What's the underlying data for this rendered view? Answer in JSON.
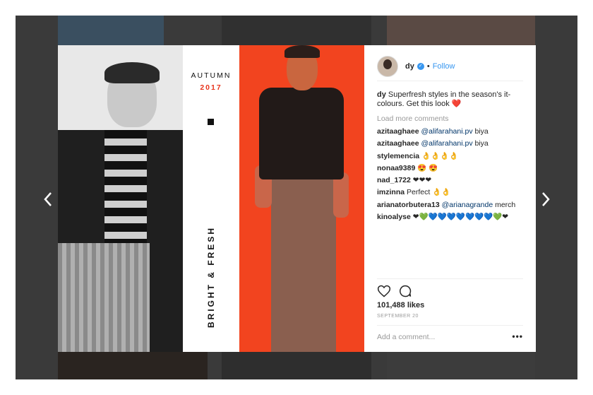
{
  "post": {
    "username": "dy",
    "dot": "•",
    "follow_label": "Follow",
    "caption_user": "dy",
    "caption_text": "Superfresh styles in the season's it-colours. Get this look ❤️",
    "load_more": "Load more comments",
    "likes": "101,488 likes",
    "date": "SEPTEMBER 20",
    "add_comment_placeholder": "Add a comment...",
    "more_label": "•••"
  },
  "image_text": {
    "autumn": "AUTUMN",
    "year": "2017",
    "tagline": "BRIGHT & FRESH"
  },
  "comments": [
    {
      "user": "azitaaghaee",
      "mention": "@alifarahani.pv",
      "text": " biya"
    },
    {
      "user": "azitaaghaee",
      "mention": "@alifarahani.pv",
      "text": " biya"
    },
    {
      "user": "stylemencia",
      "mention": "",
      "text": "👌👌👌👌"
    },
    {
      "user": "nonaa9389",
      "mention": "",
      "text": "😍 😍"
    },
    {
      "user": "nad_1722",
      "mention": "",
      "text": "❤❤❤"
    },
    {
      "user": "imzinna",
      "mention": "",
      "text": "Perfect 👌👌"
    },
    {
      "user": "arianatorbutera13",
      "mention": "@arianagrande",
      "text": " merch"
    },
    {
      "user": "kinoalyse",
      "mention": "",
      "text": "❤💚💙💙💙💙💙💙💙💚❤"
    }
  ],
  "colors": {
    "accent_blue": "#3897f0",
    "brand_red": "#f2441f",
    "year_red": "#e8341c"
  },
  "icons": [
    "chevron-left-icon",
    "chevron-right-icon",
    "heart-icon",
    "comment-icon",
    "verified-icon"
  ]
}
